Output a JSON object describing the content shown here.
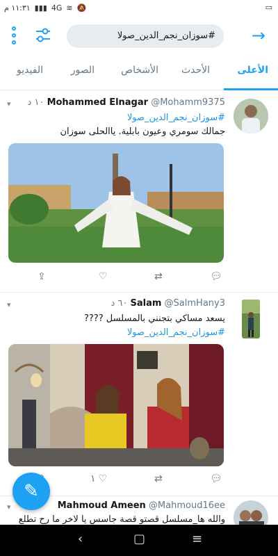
{
  "status": {
    "time": "١١:٣١ م",
    "network": "4G"
  },
  "search": {
    "query": "#سوزان_نجم_الدين_صولا"
  },
  "tabs": [
    "الأعلى",
    "الأحدث",
    "الأشخاص",
    "الصور",
    "الفيديو"
  ],
  "tweets": [
    {
      "name": "Mohammed Elnagar",
      "handle": "@Mohamm9375",
      "time": "١٠ د",
      "tags": "#سوزان_نجم_الدين_صولا",
      "text": "جمالك سومري وعيون بابلية. ياالحلى سوزان",
      "likes": "",
      "retweets": ""
    },
    {
      "name": "Salam",
      "handle": "@SalmHany3",
      "time": "٦٠ د",
      "text": "يسعد مساكي بتجنني بالمسلسل ????",
      "tags": "#سوزان_نجم_الدين_صولا",
      "likes": "١",
      "retweets": ""
    },
    {
      "name": "Mahmoud Ameen",
      "handle": "@Mahmoud16ee",
      "text": "والله ها_مسلسل قصتو قصة جاسس يا لاخر ما رح تطلع"
    }
  ],
  "colors": {
    "accent": "#1da1f2",
    "link": "#1b95e0",
    "muted": "#657786"
  },
  "icons": [
    "more-vertical-icon",
    "filter-icon",
    "back-arrow-icon",
    "share-icon",
    "like-icon",
    "retweet-icon",
    "reply-icon",
    "compose-icon"
  ]
}
